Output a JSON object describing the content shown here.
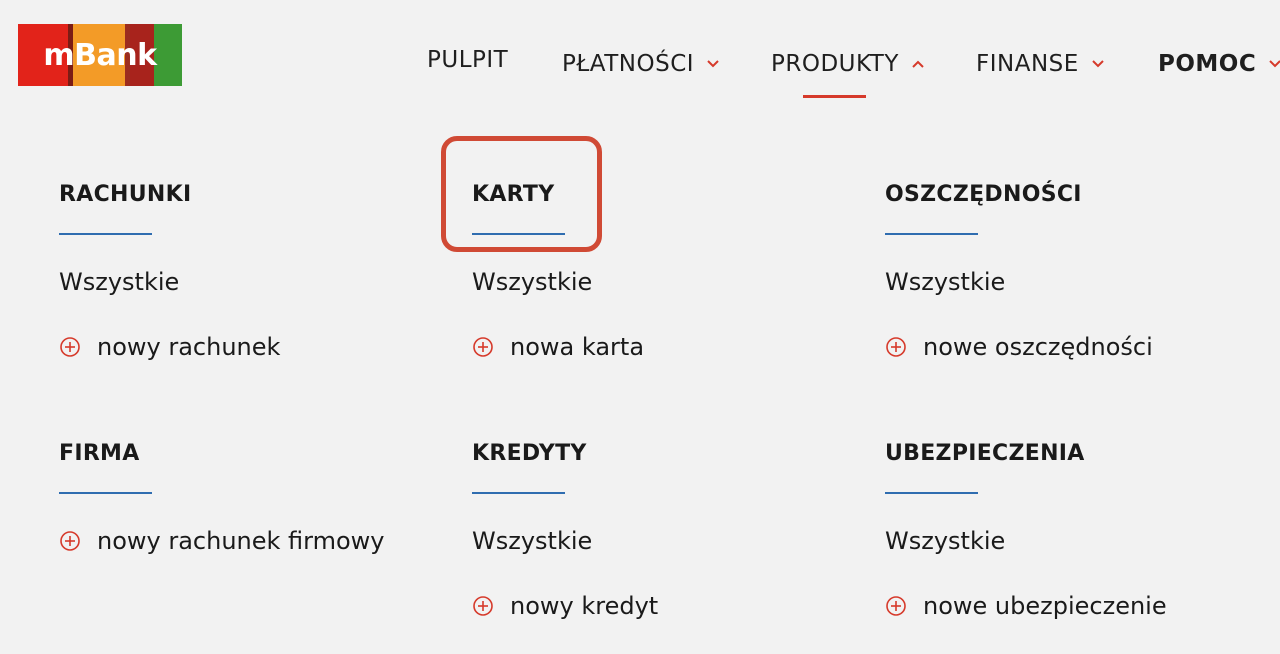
{
  "logo": {
    "text": "mBank"
  },
  "nav": {
    "items": [
      {
        "label": "PULPIT"
      },
      {
        "label": "PŁATNOŚCI"
      },
      {
        "label": "PRODUKTY"
      },
      {
        "label": "FINANSE"
      },
      {
        "label": "POMOC"
      }
    ]
  },
  "sections": [
    {
      "title": "RACHUNKI",
      "links": [
        "Wszystkie"
      ],
      "add": "nowy rachunek"
    },
    {
      "title": "KARTY",
      "links": [
        "Wszystkie"
      ],
      "add": "nowa karta"
    },
    {
      "title": "OSZCZĘDNOŚCI",
      "links": [
        "Wszystkie"
      ],
      "add": "nowe oszczędności"
    },
    {
      "title": "FIRMA",
      "links": [],
      "add": "nowy rachunek firmowy"
    },
    {
      "title": "KREDYTY",
      "links": [
        "Wszystkie"
      ],
      "add": "nowy kredyt"
    },
    {
      "title": "UBEZPIECZENIA",
      "links": [
        "Wszystkie"
      ],
      "add": "nowe ubezpieczenie"
    }
  ],
  "colors": {
    "accent_red": "#d63a2b",
    "rule_blue": "#2f6db0",
    "highlight": "#d04a35"
  }
}
